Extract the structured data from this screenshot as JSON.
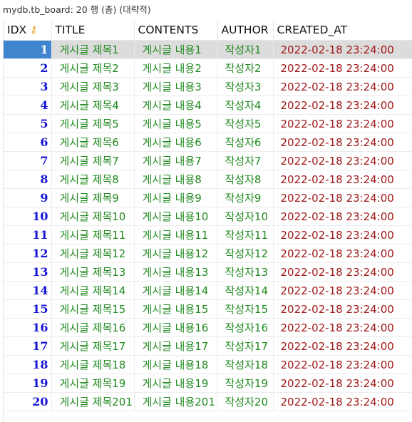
{
  "caption": "mydb.tb_board: 20 행 (총) (대략적)",
  "columns": [
    "IDX",
    "TITLE",
    "CONTENTS",
    "AUTHOR",
    "CREATED_AT"
  ],
  "key_icon": "key-icon",
  "selected_row": 0,
  "rows": [
    [
      "1",
      "게시글 제목1",
      "게시글 내용1",
      "작성자1",
      "2022-02-18 23:24:00"
    ],
    [
      "2",
      "게시글 제목2",
      "게시글 내용2",
      "작성자2",
      "2022-02-18 23:24:00"
    ],
    [
      "3",
      "게시글 제목3",
      "게시글 내용3",
      "작성자3",
      "2022-02-18 23:24:00"
    ],
    [
      "4",
      "게시글 제목4",
      "게시글 내용4",
      "작성자4",
      "2022-02-18 23:24:00"
    ],
    [
      "5",
      "게시글 제목5",
      "게시글 내용5",
      "작성자5",
      "2022-02-18 23:24:00"
    ],
    [
      "6",
      "게시글 제목6",
      "게시글 내용6",
      "작성자6",
      "2022-02-18 23:24:00"
    ],
    [
      "7",
      "게시글 제목7",
      "게시글 내용7",
      "작성자7",
      "2022-02-18 23:24:00"
    ],
    [
      "8",
      "게시글 제목8",
      "게시글 내용8",
      "작성자8",
      "2022-02-18 23:24:00"
    ],
    [
      "9",
      "게시글 제목9",
      "게시글 내용9",
      "작성자9",
      "2022-02-18 23:24:00"
    ],
    [
      "10",
      "게시글 제목10",
      "게시글 내용10",
      "작성자10",
      "2022-02-18 23:24:00"
    ],
    [
      "11",
      "게시글 제목11",
      "게시글 내용11",
      "작성자11",
      "2022-02-18 23:24:00"
    ],
    [
      "12",
      "게시글 제목12",
      "게시글 내용12",
      "작성자12",
      "2022-02-18 23:24:00"
    ],
    [
      "13",
      "게시글 제목13",
      "게시글 내용13",
      "작성자13",
      "2022-02-18 23:24:00"
    ],
    [
      "14",
      "게시글 제목14",
      "게시글 내용14",
      "작성자14",
      "2022-02-18 23:24:00"
    ],
    [
      "15",
      "게시글 제목15",
      "게시글 내용15",
      "작성자15",
      "2022-02-18 23:24:00"
    ],
    [
      "16",
      "게시글 제목16",
      "게시글 내용16",
      "작성자16",
      "2022-02-18 23:24:00"
    ],
    [
      "17",
      "게시글 제목17",
      "게시글 내용17",
      "작성자17",
      "2022-02-18 23:24:00"
    ],
    [
      "18",
      "게시글 제목18",
      "게시글 내용18",
      "작성자18",
      "2022-02-18 23:24:00"
    ],
    [
      "19",
      "게시글 제목19",
      "게시글 내용19",
      "작성자19",
      "2022-02-18 23:24:00"
    ],
    [
      "20",
      "게시글 제목201",
      "게시글 내용201",
      "작성자20",
      "2022-02-18 23:24:00"
    ]
  ],
  "colors": {
    "idx": "#1515d6",
    "text": "#218a21",
    "date": "#a01818",
    "selection": "#3f86cf",
    "key": "#e8a01b"
  }
}
